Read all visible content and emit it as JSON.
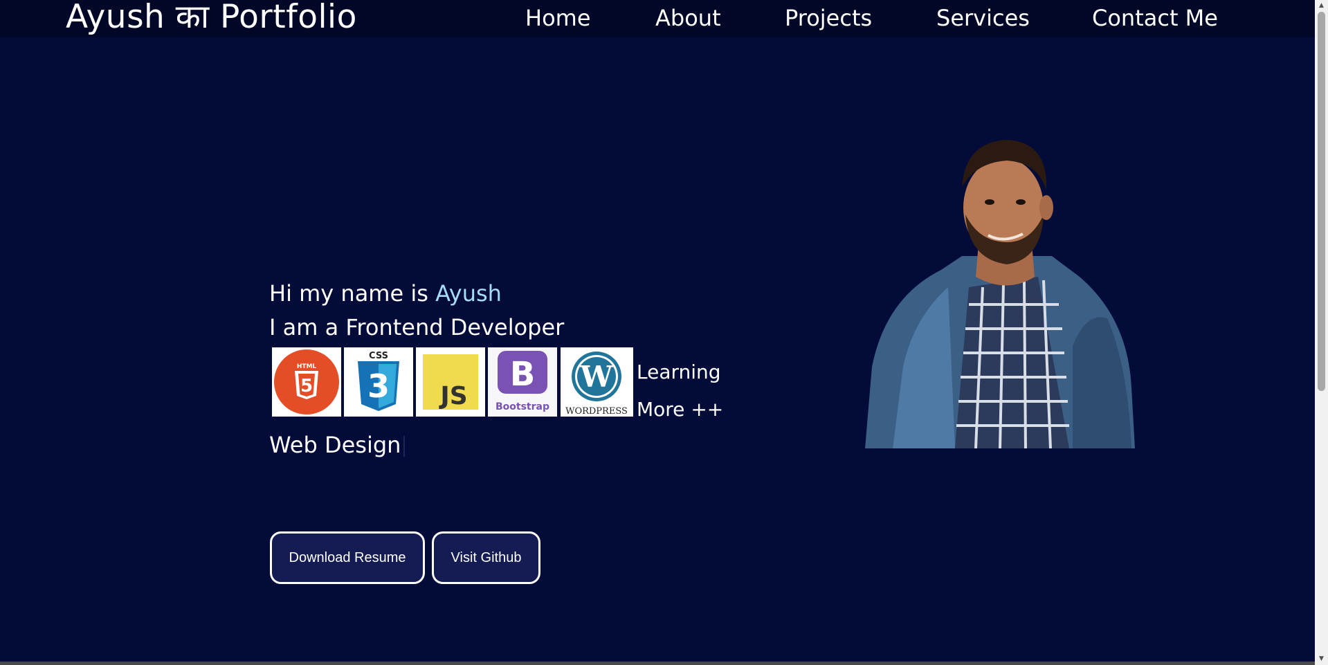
{
  "navbar": {
    "brand": "Ayush का Portfolio",
    "links": [
      {
        "label": "Home"
      },
      {
        "label": "About"
      },
      {
        "label": "Projects"
      },
      {
        "label": "Services"
      },
      {
        "label": "Contact Me"
      }
    ]
  },
  "hero": {
    "intro_prefix": "Hi my name is ",
    "intro_name": "Ayush",
    "role": "I am a Frontend Developer",
    "tech_icons": [
      {
        "name": "html5-icon",
        "label": "HTML",
        "color": "#e44d26"
      },
      {
        "name": "css3-icon",
        "label": "CSS",
        "color": "#1572b6"
      },
      {
        "name": "javascript-icon",
        "label": "JS",
        "color": "#f0db4f"
      },
      {
        "name": "bootstrap-icon",
        "label": "Bootstrap",
        "color": "#7952b3"
      },
      {
        "name": "wordpress-icon",
        "label": "WordPress",
        "color": "#21759b"
      }
    ],
    "learning_line1": "Learning",
    "learning_line2": "More ++",
    "typing_text": "Web Design"
  },
  "buttons": {
    "resume": "Download Resume",
    "github": "Visit Github"
  },
  "colors": {
    "background": "#030b38",
    "navbar": "#010827",
    "accent": "#a6dcf5",
    "button_bg": "#141c53"
  }
}
